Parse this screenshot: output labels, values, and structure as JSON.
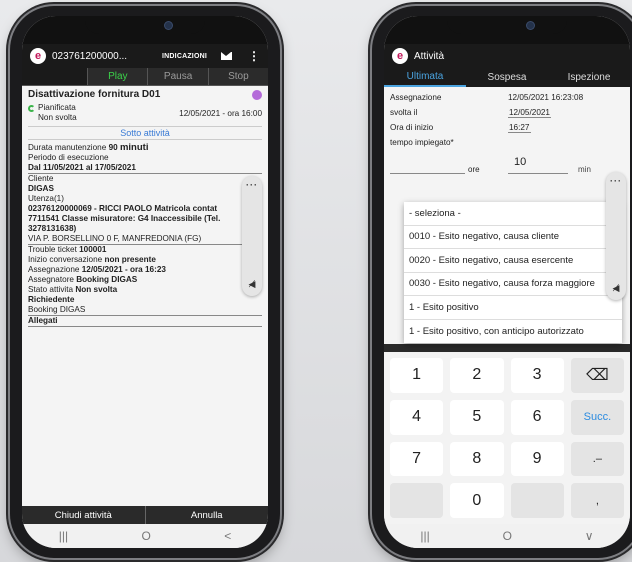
{
  "left": {
    "app_title": "023761200000...",
    "header_action": "INDICAZIONI",
    "controls": [
      "Play",
      "Pausa",
      "Stop"
    ],
    "task_title": "Disattivazione fornitura D01",
    "status_planned": "Pianificata",
    "status_not_done": "Non svolta",
    "schedule": "12/05/2021 - ora 16:00",
    "subtab": "Sotto attività",
    "duration_label": "Durata manutenzione",
    "duration_value": "90",
    "duration_unit": "minuti",
    "period_label": "Periodo di esecuzione",
    "period_value": "Dal 11/05/2021 al 17/05/2021",
    "client_label": "Cliente",
    "client_value": "DIGAS",
    "utenza_label": "Utenza(1)",
    "utenza_line1": "02376120000069 - RICCI PAOLO Matricola contat",
    "utenza_line2": "7711541 Classe misuratore: G4 Inaccessibile (Tel.",
    "utenza_line3": "3278131638)",
    "address": "VIA P. BORSELLINO 0 F, MANFREDONIA (FG)",
    "ticket_label": "Trouble ticket",
    "ticket_value": "100001",
    "conversation_label": "Inizio conversazione",
    "conversation_value": "non presente",
    "assignment_label": "Assegnazione",
    "assignment_value": "12/05/2021 - ora 16:23",
    "assigner_label": "Assegnatore",
    "assigner_value": "Booking DIGAS",
    "activity_status_label": "Stato attivita",
    "activity_status_value": "Non svolta",
    "requester_label": "Richiedente",
    "requester_value": "Booking DIGAS",
    "attachments_label": "Allegati",
    "close_button": "Chiudi attività",
    "cancel_button": "Annulla",
    "nav": [
      "|||",
      "O",
      "<"
    ]
  },
  "right": {
    "app_title": "Attività",
    "tabs": [
      "Ultimata",
      "Sospesa",
      "Ispezione"
    ],
    "assignment_label": "Assegnazione",
    "assignment_value": "12/05/2021 16:23:08",
    "done_label": "svolta il",
    "done_value": "12/05/2021",
    "start_label": "Ora di inizio",
    "start_value": "16:27",
    "time_label": "tempo impiegato*",
    "hours_unit": "ore",
    "minutes_value": "10",
    "minutes_unit": "min",
    "options": [
      "- seleziona -",
      "0010 - Esito negativo, causa cliente",
      "0020 - Esito negativo, causa esercente",
      "0030 - Esito negativo, causa forza maggiore",
      "1 - Esito positivo",
      "1 - Esito positivo, con anticipo autorizzato"
    ],
    "keys": [
      "1",
      "2",
      "3",
      "⌫",
      "4",
      "5",
      "6",
      "Succ.",
      "7",
      "8",
      "9",
      ".–",
      "",
      "0",
      "",
      ","
    ],
    "nav": [
      "|||",
      "O",
      "∨"
    ]
  }
}
